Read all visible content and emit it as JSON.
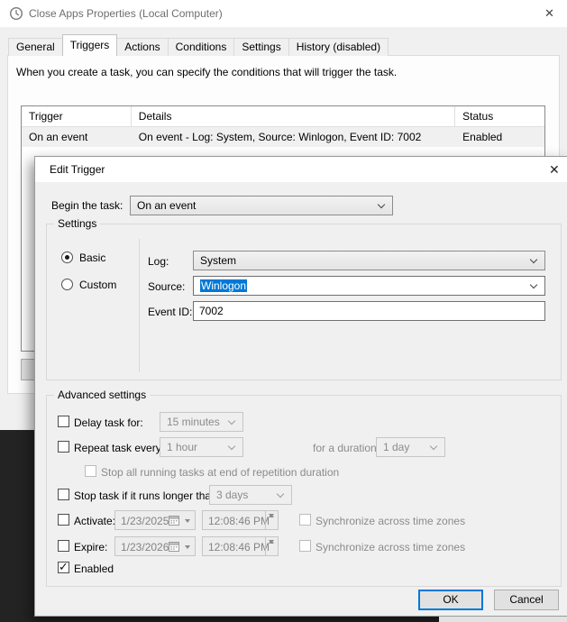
{
  "colors": {
    "accent": "#0078d7",
    "selection_bg": "#0078d7",
    "selection_text": "#ffffff",
    "window_bg": "#f0f0f0",
    "backdrop": "#232323"
  },
  "icons": {
    "close": "✕",
    "check": "✓",
    "clock": "clock-icon",
    "chevron": "chevron-down-icon",
    "calendar": "calendar-icon"
  },
  "parent": {
    "title": "Close Apps Properties (Local Computer)",
    "tabs": [
      "General",
      "Triggers",
      "Actions",
      "Conditions",
      "Settings",
      "History (disabled)"
    ],
    "active_tab": "Triggers",
    "description": "When you create a task, you can specify the conditions that will trigger the task.",
    "table": {
      "columns": [
        "Trigger",
        "Details",
        "Status"
      ],
      "rows": [
        {
          "trigger": "On an event",
          "details": "On event - Log: System, Source: Winlogon, Event ID: 7002",
          "status": "Enabled"
        }
      ]
    }
  },
  "dialog": {
    "title": "Edit Trigger",
    "begin_label": "Begin the task:",
    "begin_value": "On an event",
    "settings": {
      "legend": "Settings",
      "basic_label": "Basic",
      "custom_label": "Custom",
      "log_label": "Log:",
      "log_value": "System",
      "source_label": "Source:",
      "source_value": "Winlogon",
      "event_label": "Event ID:",
      "event_value": "7002"
    },
    "advanced": {
      "legend": "Advanced settings",
      "delay_label": "Delay task for:",
      "delay_value": "15 minutes",
      "repeat_label": "Repeat task every:",
      "repeat_value": "1 hour",
      "duration_label": "for a duration of:",
      "duration_value": "1 day",
      "stop_all_label": "Stop all running tasks at end of repetition duration",
      "stop_task_label": "Stop task if it runs longer than:",
      "stop_task_value": "3 days",
      "activate_label": "Activate:",
      "activate_date": "1/23/2025",
      "activate_time": "12:08:46 PM",
      "expire_label": "Expire:",
      "expire_date": "1/23/2026",
      "expire_time": "12:08:46 PM",
      "sync_label": "Synchronize across time zones",
      "enabled_label": "Enabled",
      "enabled_checked": true
    },
    "ok": "OK",
    "cancel": "Cancel"
  }
}
